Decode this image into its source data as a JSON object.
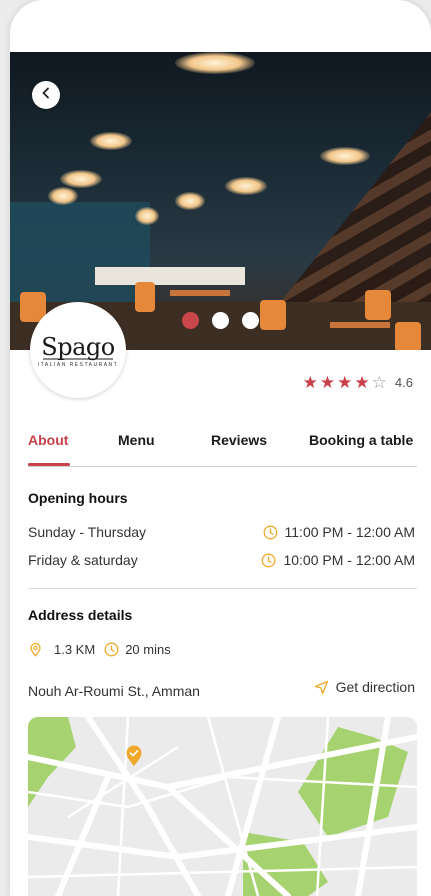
{
  "restaurant": {
    "logo_name": "Spago",
    "logo_sub": "ITALIAN RESTAURANT",
    "rating": 4.6,
    "rating_label": "4.6",
    "stars_filled": 4,
    "stars_total": 5
  },
  "carousel": {
    "count": 3,
    "active_index": 0
  },
  "tabs": [
    {
      "label": "About"
    },
    {
      "label": "Menu"
    },
    {
      "label": "Reviews"
    },
    {
      "label": "Booking a table"
    }
  ],
  "opening_hours": {
    "title": "Opening hours",
    "rows": [
      {
        "days": "Sunday - Thursday",
        "hours": "11:00 PM - 12:00 AM"
      },
      {
        "days": "Friday & saturday",
        "hours": "10:00 PM - 12:00 AM"
      }
    ]
  },
  "address": {
    "title": "Address details",
    "distance": "1.3 KM",
    "duration": "20 mins",
    "street": "Nouh Ar-Roumi St., Amman",
    "direction_label": "Get direction"
  },
  "colors": {
    "accent": "#c9404a",
    "icon_orange": "#f0a92a",
    "map_green": "#a6d36f",
    "map_bg": "#ebebeb"
  },
  "icons": {
    "back": "chevron-left-icon",
    "clock": "clock-icon",
    "location": "location-pin-icon",
    "direction": "navigation-arrow-icon",
    "map_marker": "map-marker-icon"
  }
}
